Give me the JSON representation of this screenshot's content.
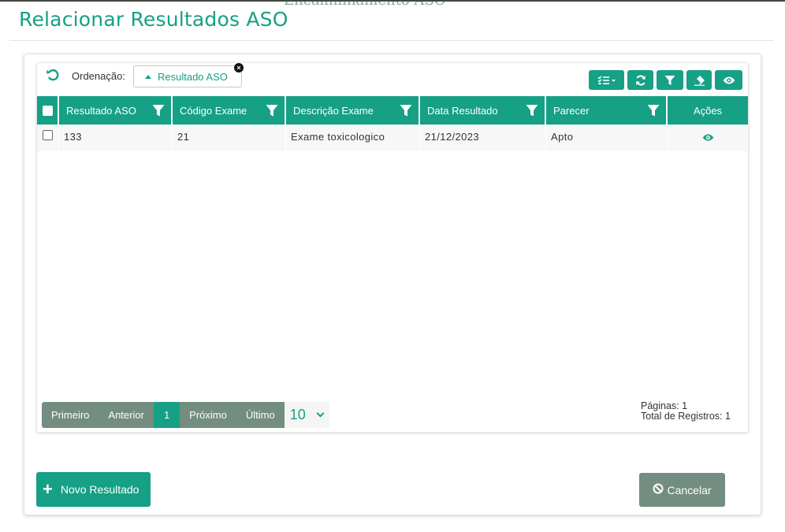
{
  "page": {
    "background_text": "Encaminhamento ASO",
    "title": "Relacionar Resultados ASO"
  },
  "sort": {
    "label": "Ordenação:",
    "chip_label": "Resultado ASO",
    "chip_close": "×"
  },
  "toolbar": {
    "icons": [
      "columns-icon",
      "refresh-icon",
      "filter-icon",
      "eraser-icon",
      "eye-icon"
    ]
  },
  "table": {
    "columns": [
      "Resultado ASO",
      "Código Exame",
      "Descrição Exame",
      "Data Resultado",
      "Parecer",
      "Ações"
    ],
    "rows": [
      {
        "resultado_aso": "133",
        "codigo_exame": "21",
        "descricao_exame": "Exame toxicologico",
        "data_resultado": "21/12/2023",
        "parecer": "Apto"
      }
    ]
  },
  "pagination": {
    "first": "Primeiro",
    "previous": "Anterior",
    "current": "1",
    "next": "Próximo",
    "last": "Último",
    "page_size": "10",
    "pages_text": "Páginas: 1",
    "total_text": "Total de Registros: 1"
  },
  "actions": {
    "new_label": "Novo Resultado",
    "new_icon": "+",
    "cancel_label": "Cancelar"
  },
  "colors": {
    "primary": "#16a085",
    "muted": "#738d80"
  }
}
